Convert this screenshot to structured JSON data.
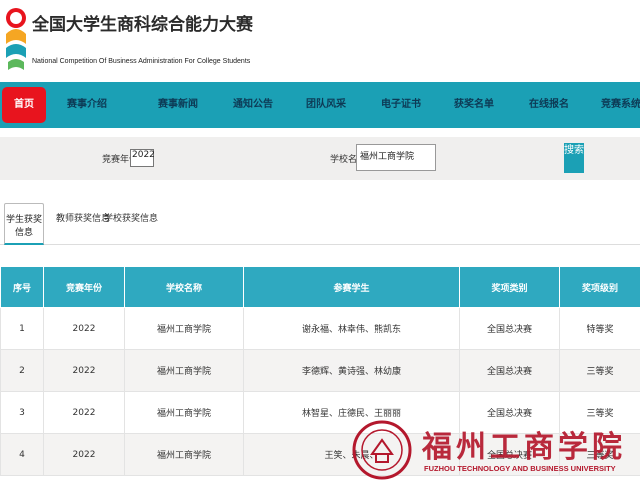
{
  "header": {
    "title_cn": "全国大学生商科综合能力大赛",
    "title_en": "National Competition Of Business Administration For College Students"
  },
  "nav": {
    "home": "首页",
    "items": [
      "赛事介绍",
      "赛事新闻",
      "通知公告",
      "团队风采",
      "电子证书",
      "获奖名单",
      "在线报名",
      "竞赛系统"
    ]
  },
  "search": {
    "year_label": "竞赛年份：",
    "year_value": "2022",
    "school_label": "学校名称：",
    "school_value": "福州工商学院",
    "button": "搜索"
  },
  "tabs": {
    "active": "学生获奖信息",
    "items": [
      "教师获奖信息",
      "学校获奖信息"
    ]
  },
  "table": {
    "headers": [
      "序号",
      "竞赛年份",
      "学校名称",
      "参赛学生",
      "奖项类别",
      "奖项级别"
    ],
    "rows": [
      [
        "1",
        "2022",
        "福州工商学院",
        "谢永福、林幸伟、熊凯东",
        "全国总决赛",
        "特等奖"
      ],
      [
        "2",
        "2022",
        "福州工商学院",
        "李德辉、黄诗强、林幼康",
        "全国总决赛",
        "三等奖"
      ],
      [
        "3",
        "2022",
        "福州工商学院",
        "林智星、庄德民、王丽丽",
        "全国总决赛",
        "三等奖"
      ],
      [
        "4",
        "2022",
        "福州工商学院",
        "王笑、朱晨、",
        "全国总决赛",
        "三等奖"
      ]
    ]
  },
  "watermark": {
    "name_cn": "福州工商学院",
    "name_en": "FUZHOU TECHNOLOGY AND BUSINESS UNIVERSITY"
  },
  "colors": {
    "nav_bg": "#1ba0b5",
    "home_bg": "#e8141e",
    "table_header_bg": "#2fa9c0",
    "watermark": "#b4182d"
  }
}
